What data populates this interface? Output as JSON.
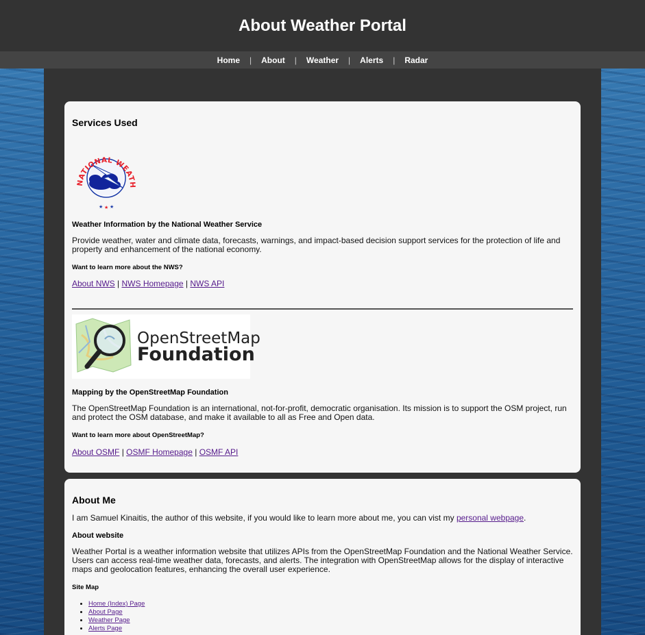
{
  "header": {
    "title": "About Weather Portal"
  },
  "nav": {
    "items": [
      {
        "label": "Home"
      },
      {
        "label": "About"
      },
      {
        "label": "Weather"
      },
      {
        "label": "Alerts"
      },
      {
        "label": "Radar"
      }
    ],
    "separator": "|"
  },
  "services": {
    "title": "Services Used",
    "nws": {
      "logo_text": "NATIONAL WEATHER SERVICE",
      "heading": "Weather Information by the National Weather Service",
      "description": "Provide weather, water and climate data, forecasts, warnings, and impact-based decision support services for the protection of life and property and enhancement of the national economy.",
      "learn_more": "Want to learn more about the NWS?",
      "links": [
        "About NWS",
        "NWS Homepage",
        "NWS API"
      ]
    },
    "osm": {
      "logo_line1": "OpenStreetMap",
      "logo_line2": "Foundation",
      "heading": "Mapping by the OpenStreetMap Foundation",
      "description": "The OpenStreetMap Foundation is an international, not-for-profit, democratic organisation. Its mission is to support the OSM project, run and protect the OSM database, and make it available to all as Free and Open data.",
      "learn_more": "Want to learn more about OpenStreetMap?",
      "links": [
        "About OSMF",
        "OSMF Homepage",
        "OSMF API"
      ]
    },
    "link_separator": "|"
  },
  "about_me": {
    "title": "About Me",
    "intro_before": "I am Samuel Kinaitis, the author of this website, if you would like to learn more about me, you can vist my ",
    "intro_link": "personal webpage",
    "intro_after": ".",
    "website_heading": "About website",
    "website_text": "Weather Portal is a weather information website that utilizes APIs from the OpenStreetMap Foundation and the National Weather Service. Users can access real-time weather data, forecasts, and alerts. The integration with OpenStreetMap allows for the display of interactive maps and geolocation features, enhancing the overall user experience.",
    "sitemap_heading": "Site Map",
    "sitemap": [
      "Home (Index) Page",
      "About Page",
      "Weather Page",
      "Alerts Page"
    ]
  },
  "colors": {
    "header_bg": "#333333",
    "nav_bg": "#444444",
    "card_bg": "#f6f6f6",
    "link": "#551a8b",
    "nws_red": "#e8212b",
    "nws_blue": "#1a3aa8"
  }
}
